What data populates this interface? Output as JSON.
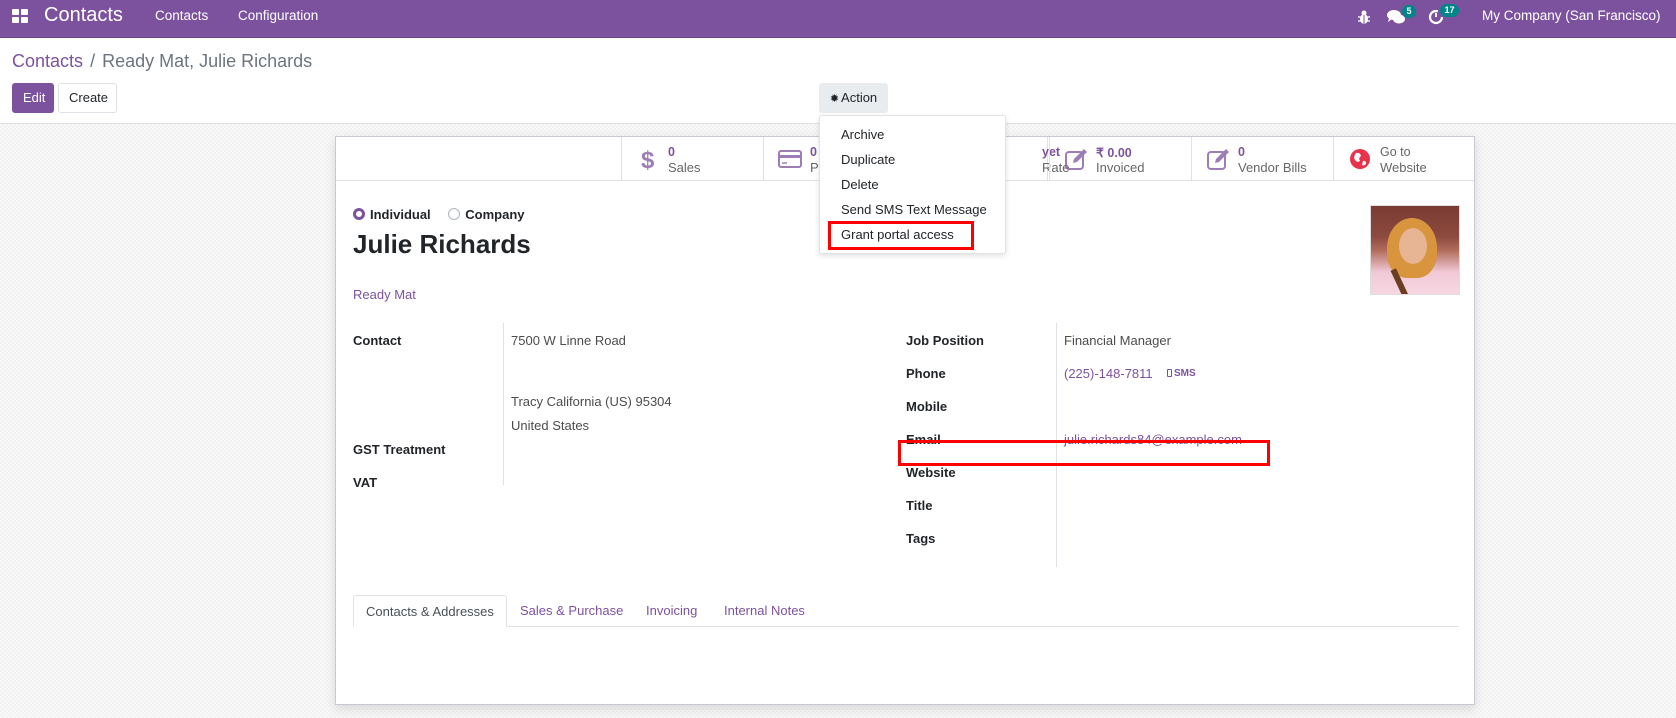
{
  "navbar": {
    "app_name": "Contacts",
    "menus": [
      "Contacts",
      "Configuration"
    ],
    "messages_count": "5",
    "activities_count": "17",
    "company": "My Company (San Francisco)",
    "icons": [
      "apps-grid-icon",
      "bug-icon",
      "chat-icon",
      "clock-icon"
    ]
  },
  "breadcrumb": {
    "parent": "Contacts",
    "separator": "/",
    "current": "Ready Mat, Julie Richards"
  },
  "toolbar": {
    "edit_label": "Edit",
    "create_label": "Create",
    "action_label": "Action"
  },
  "action_menu": {
    "items": [
      "Archive",
      "Duplicate",
      "Delete",
      "Send SMS Text Message",
      "Grant portal access"
    ],
    "highlighted_item": "Grant portal access"
  },
  "stat_buttons": [
    {
      "value": "0",
      "label": "Sales",
      "icon": "dollar-icon"
    },
    {
      "value": "0",
      "label": "P",
      "icon": "credit-card-icon"
    },
    {
      "value": "",
      "label": "",
      "icon": ""
    },
    {
      "value": "yet",
      "label": "Rate",
      "icon": ""
    },
    {
      "value": "₹ 0.00",
      "label": "Invoiced",
      "icon": "edit-icon"
    },
    {
      "value": "0",
      "label": "Vendor Bills",
      "icon": "edit-icon"
    },
    {
      "value": "Go to",
      "label": "Website",
      "icon": "globe-icon"
    }
  ],
  "partner": {
    "type_options": [
      "Individual",
      "Company"
    ],
    "type_selected": "Individual",
    "name": "Julie Richards",
    "parent_company": "Ready Mat"
  },
  "fields_left": {
    "contact_label": "Contact",
    "address": {
      "street": "7500 W Linne Road",
      "city_line": "Tracy  California (US)  95304",
      "country": "United States"
    },
    "gst_label": "GST Treatment",
    "vat_label": "VAT"
  },
  "fields_right": {
    "job_position_label": "Job Position",
    "job_position": "Financial Manager",
    "phone_label": "Phone",
    "phone": "(225)-148-7811",
    "sms_label": "SMS",
    "mobile_label": "Mobile",
    "email_label": "Email",
    "email": "julie.richards84@example.com",
    "website_label": "Website",
    "title_label": "Title",
    "tags_label": "Tags"
  },
  "tabs": [
    {
      "label": "Contacts & Addresses",
      "active": true
    },
    {
      "label": "Sales & Purchase",
      "active": false
    },
    {
      "label": "Invoicing",
      "active": false
    },
    {
      "label": "Internal Notes",
      "active": false
    }
  ],
  "colors": {
    "brand": "#7c529e",
    "badge": "#00868a",
    "highlight": "#ff0000"
  }
}
